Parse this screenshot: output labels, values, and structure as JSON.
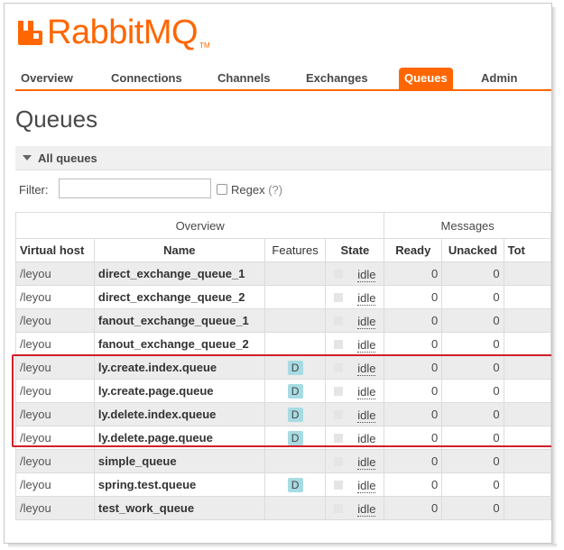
{
  "brand": {
    "name": "RabbitMQ",
    "tm": "TM",
    "color": "#ff6600"
  },
  "nav": {
    "items": [
      {
        "label": "Overview",
        "active": false
      },
      {
        "label": "Connections",
        "active": false
      },
      {
        "label": "Channels",
        "active": false
      },
      {
        "label": "Exchanges",
        "active": false
      },
      {
        "label": "Queues",
        "active": true
      },
      {
        "label": "Admin",
        "active": false
      }
    ]
  },
  "page": {
    "title": "Queues"
  },
  "section": {
    "title": "All queues",
    "icon": "collapse-triangle-icon"
  },
  "filter": {
    "label": "Filter:",
    "value": "",
    "placeholder": "",
    "regex_label": "Regex",
    "regex_hint": "(?)",
    "regex_checked": false
  },
  "table": {
    "groups": {
      "overview": "Overview",
      "messages": "Messages"
    },
    "columns": {
      "vhost": "Virtual host",
      "name": "Name",
      "features": "Features",
      "state": "State",
      "ready": "Ready",
      "unacked": "Unacked",
      "total": "Tot"
    },
    "rows": [
      {
        "vhost": "/leyou",
        "name": "direct_exchange_queue_1",
        "feature": "",
        "state": "idle",
        "ready": "0",
        "unacked": "0"
      },
      {
        "vhost": "/leyou",
        "name": "direct_exchange_queue_2",
        "feature": "",
        "state": "idle",
        "ready": "0",
        "unacked": "0"
      },
      {
        "vhost": "/leyou",
        "name": "fanout_exchange_queue_1",
        "feature": "",
        "state": "idle",
        "ready": "0",
        "unacked": "0"
      },
      {
        "vhost": "/leyou",
        "name": "fanout_exchange_queue_2",
        "feature": "",
        "state": "idle",
        "ready": "0",
        "unacked": "0"
      },
      {
        "vhost": "/leyou",
        "name": "ly.create.index.queue",
        "feature": "D",
        "state": "idle",
        "ready": "0",
        "unacked": "0"
      },
      {
        "vhost": "/leyou",
        "name": "ly.create.page.queue",
        "feature": "D",
        "state": "idle",
        "ready": "0",
        "unacked": "0"
      },
      {
        "vhost": "/leyou",
        "name": "ly.delete.index.queue",
        "feature": "D",
        "state": "idle",
        "ready": "0",
        "unacked": "0"
      },
      {
        "vhost": "/leyou",
        "name": "ly.delete.page.queue",
        "feature": "D",
        "state": "idle",
        "ready": "0",
        "unacked": "0"
      },
      {
        "vhost": "/leyou",
        "name": "simple_queue",
        "feature": "",
        "state": "idle",
        "ready": "0",
        "unacked": "0"
      },
      {
        "vhost": "/leyou",
        "name": "spring.test.queue",
        "feature": "D",
        "state": "idle",
        "ready": "0",
        "unacked": "0"
      },
      {
        "vhost": "/leyou",
        "name": "test_work_queue",
        "feature": "",
        "state": "idle",
        "ready": "0",
        "unacked": "0"
      }
    ]
  },
  "colors": {
    "accent": "#ff6600",
    "durable_badge": "#a7dbe3",
    "highlight_box": "#d11f2a"
  }
}
